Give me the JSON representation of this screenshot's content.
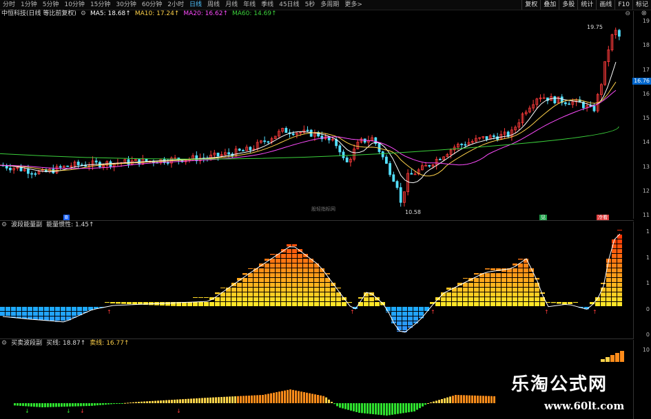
{
  "toolbar": {
    "stock_name": "中恒科技(日线 等比前复权)",
    "periods": [
      "分时",
      "1分钟",
      "5分钟",
      "10分钟",
      "15分钟",
      "30分钟",
      "60分钟",
      "2小时",
      "日线",
      "周线",
      "月线",
      "年线",
      "季线",
      "45日线",
      "5秒",
      "多周期",
      "更多>"
    ],
    "active_period": "日线",
    "right_buttons": [
      "复权",
      "叠加",
      "多股",
      "统计",
      "画线",
      "F10",
      "标记"
    ]
  },
  "main_panel": {
    "legend": [
      {
        "label": "MA5: 18.68↑",
        "color": "#ffffff"
      },
      {
        "label": "MA10: 17.24↑",
        "color": "#ffd24a"
      },
      {
        "label": "MA20: 16.62↑",
        "color": "#ff4cff"
      },
      {
        "label": "MA60: 14.69↑",
        "color": "#3cd23c"
      }
    ],
    "axis_ticks": [
      "19",
      "18",
      "17",
      "16",
      "15",
      "14",
      "13",
      "12",
      "11"
    ],
    "current_price_tag": "16.76",
    "high_label": "19.75",
    "low_label": "10.58",
    "center_watermark": "股轻指标网",
    "badges": [
      {
        "text": "B",
        "color": "#1e64ff"
      },
      {
        "text": "见",
        "color": "#1fa04a"
      },
      {
        "text": "冷看",
        "color": "#e04040"
      }
    ]
  },
  "sub_panel1": {
    "name": "波段能量副",
    "legend_label": "能量惯性: 1.45↑",
    "axis_ticks": [
      "1",
      "1",
      "1",
      "0",
      "0"
    ]
  },
  "sub_panel2": {
    "name": "买卖波段副",
    "buy_label": "买线: 18.87↑",
    "sell_label": "卖线: 16.77↑",
    "axis_ticks": [
      "10"
    ]
  },
  "watermark": {
    "title": "乐淘公式网",
    "url": "www.60lt.com"
  },
  "colors": {
    "up": "#ff3b3b",
    "down": "#54e0ff",
    "accent": "#4fc3ff"
  }
}
